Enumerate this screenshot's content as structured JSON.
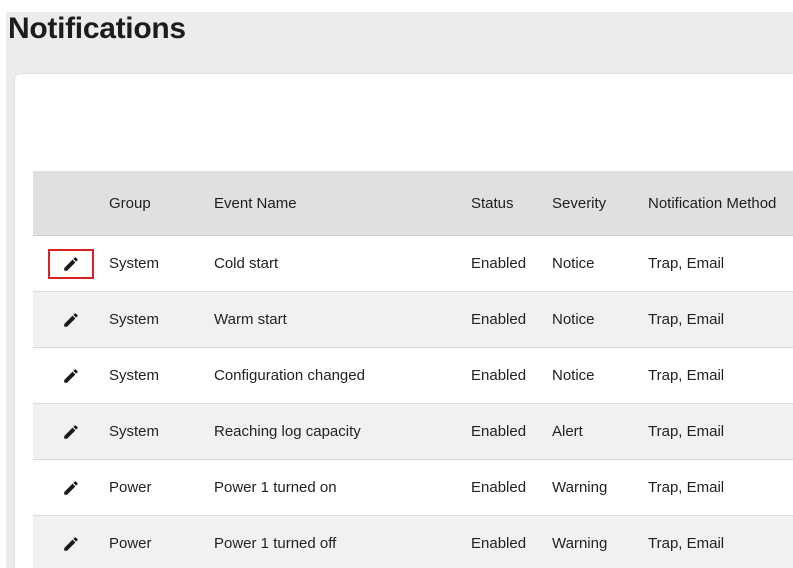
{
  "page": {
    "title": "Notifications"
  },
  "table": {
    "columns": {
      "group": "Group",
      "event_name": "Event Name",
      "status": "Status",
      "severity": "Severity",
      "notification_method": "Notification Method"
    },
    "rows": [
      {
        "group": "System",
        "event_name": "Cold start",
        "status": "Enabled",
        "severity": "Notice",
        "notification_method": "Trap, Email",
        "edit_icon": "pencil-icon"
      },
      {
        "group": "System",
        "event_name": "Warm start",
        "status": "Enabled",
        "severity": "Notice",
        "notification_method": "Trap, Email",
        "edit_icon": "pencil-icon"
      },
      {
        "group": "System",
        "event_name": "Configuration changed",
        "status": "Enabled",
        "severity": "Notice",
        "notification_method": "Trap, Email",
        "edit_icon": "pencil-icon"
      },
      {
        "group": "System",
        "event_name": "Reaching log capacity",
        "status": "Enabled",
        "severity": "Alert",
        "notification_method": "Trap, Email",
        "edit_icon": "pencil-icon"
      },
      {
        "group": "Power",
        "event_name": "Power 1 turned on",
        "status": "Enabled",
        "severity": "Warning",
        "notification_method": "Trap, Email",
        "edit_icon": "pencil-icon"
      },
      {
        "group": "Power",
        "event_name": "Power 1 turned off",
        "status": "Enabled",
        "severity": "Warning",
        "notification_method": "Trap, Email",
        "edit_icon": "pencil-icon"
      }
    ],
    "highlighted_row": 0,
    "highlight_color": "#d62222"
  }
}
